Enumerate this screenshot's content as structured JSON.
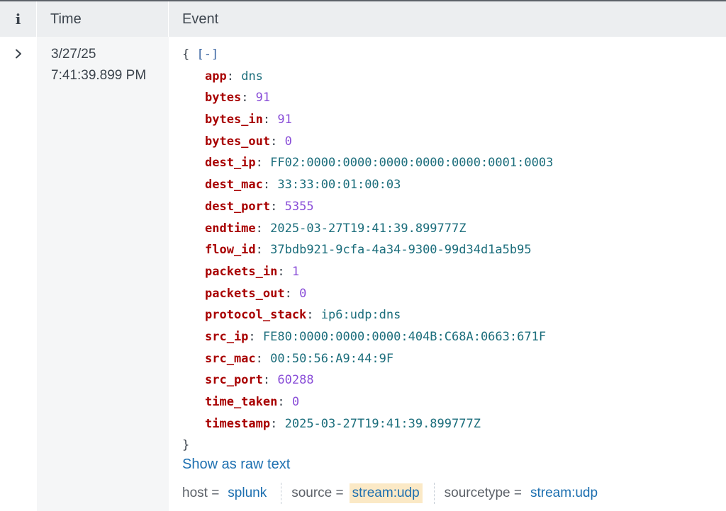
{
  "header": {
    "info_label": "i",
    "time_label": "Time",
    "event_label": "Event"
  },
  "row": {
    "expand_icon": "chevron-right-icon",
    "date": "3/27/25",
    "time": "7:41:39.899 PM"
  },
  "event": {
    "open_brace": "{",
    "collapse_label": "[-]",
    "close_brace": "}",
    "fields": [
      {
        "key": "app",
        "value": "dns",
        "type": "str"
      },
      {
        "key": "bytes",
        "value": "91",
        "type": "num"
      },
      {
        "key": "bytes_in",
        "value": "91",
        "type": "num"
      },
      {
        "key": "bytes_out",
        "value": "0",
        "type": "num"
      },
      {
        "key": "dest_ip",
        "value": "FF02:0000:0000:0000:0000:0000:0001:0003",
        "type": "str"
      },
      {
        "key": "dest_mac",
        "value": "33:33:00:01:00:03",
        "type": "str"
      },
      {
        "key": "dest_port",
        "value": "5355",
        "type": "num"
      },
      {
        "key": "endtime",
        "value": "2025-03-27T19:41:39.899777Z",
        "type": "str"
      },
      {
        "key": "flow_id",
        "value": "37bdb921-9cfa-4a34-9300-99d34d1a5b95",
        "type": "str"
      },
      {
        "key": "packets_in",
        "value": "1",
        "type": "num"
      },
      {
        "key": "packets_out",
        "value": "0",
        "type": "num"
      },
      {
        "key": "protocol_stack",
        "value": "ip6:udp:dns",
        "type": "str"
      },
      {
        "key": "src_ip",
        "value": "FE80:0000:0000:0000:404B:C68A:0663:671F",
        "type": "str"
      },
      {
        "key": "src_mac",
        "value": "00:50:56:A9:44:9F",
        "type": "str"
      },
      {
        "key": "src_port",
        "value": "60288",
        "type": "num"
      },
      {
        "key": "time_taken",
        "value": "0",
        "type": "num"
      },
      {
        "key": "timestamp",
        "value": "2025-03-27T19:41:39.899777Z",
        "type": "str"
      }
    ],
    "raw_link": "Show as raw text"
  },
  "meta": [
    {
      "label": "host =",
      "value": "splunk",
      "highlight": false
    },
    {
      "label": "source =",
      "value": "stream:udp",
      "highlight": true
    },
    {
      "label": "sourcetype =",
      "value": "stream:udp",
      "highlight": false
    }
  ],
  "colors": {
    "key": "#a80000",
    "string": "#1c6e7c",
    "number": "#8a4fd8",
    "link": "#1c6fb0",
    "highlight": "#fbe9c6"
  }
}
